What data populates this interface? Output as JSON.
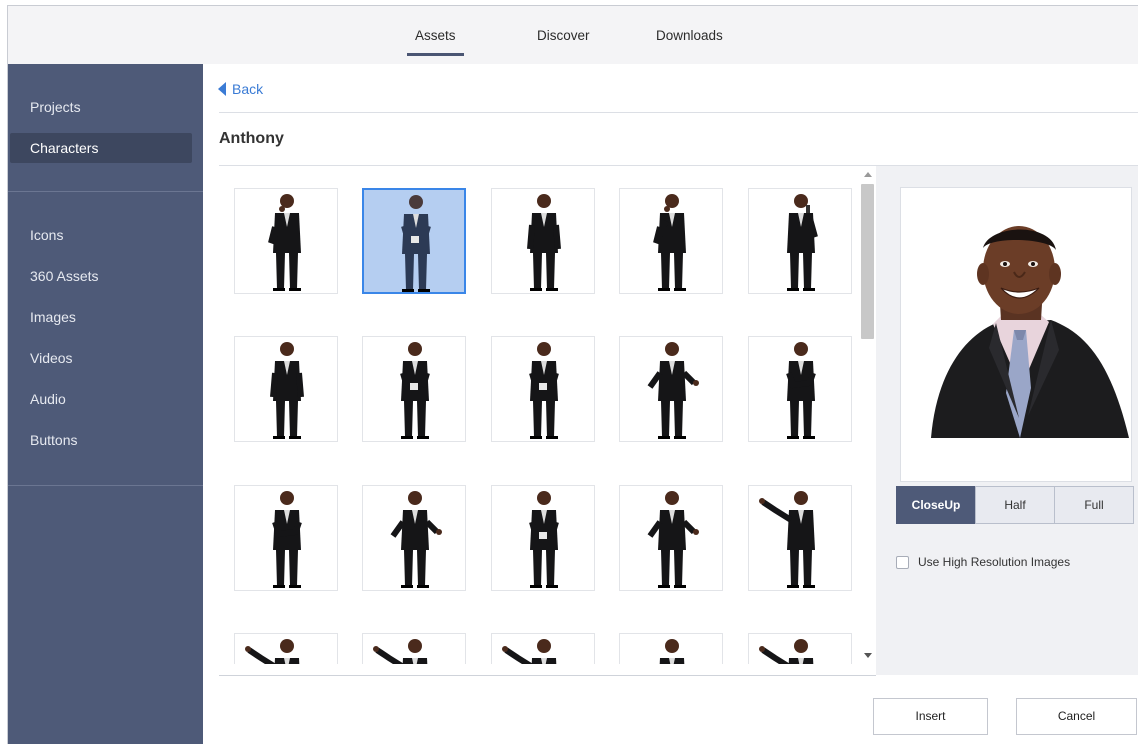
{
  "top_tabs": [
    {
      "label": "Assets",
      "active": true
    },
    {
      "label": "Discover",
      "active": false
    },
    {
      "label": "Downloads",
      "active": false
    }
  ],
  "sidebar": {
    "items": [
      {
        "label": "Projects",
        "active": false
      },
      {
        "label": "Characters",
        "active": true
      },
      {
        "label": "Icons",
        "active": false
      },
      {
        "label": "360 Assets",
        "active": false
      },
      {
        "label": "Images",
        "active": false
      },
      {
        "label": "Videos",
        "active": false
      },
      {
        "label": "Audio",
        "active": false
      },
      {
        "label": "Buttons",
        "active": false
      }
    ]
  },
  "back_label": "Back",
  "character_name": "Anthony",
  "grid": {
    "selected_index": 1,
    "thumbs": [
      {
        "pose": "hand-chin"
      },
      {
        "pose": "holding-tablet"
      },
      {
        "pose": "standing"
      },
      {
        "pose": "hand-chin"
      },
      {
        "pose": "phone"
      },
      {
        "pose": "standing"
      },
      {
        "pose": "holding-cup"
      },
      {
        "pose": "holding-cup"
      },
      {
        "pose": "gesture-cup"
      },
      {
        "pose": "hands-clasped"
      },
      {
        "pose": "arms-crossed"
      },
      {
        "pose": "open-arms"
      },
      {
        "pose": "holding-phone"
      },
      {
        "pose": "gesture"
      },
      {
        "pose": "pointing-up"
      },
      {
        "pose": "pointing"
      },
      {
        "pose": "pointing"
      },
      {
        "pose": "pointing"
      },
      {
        "pose": "standing"
      },
      {
        "pose": "pointing"
      }
    ]
  },
  "preview": {
    "view_options": [
      {
        "label": "CloseUp",
        "active": true
      },
      {
        "label": "Half",
        "active": false
      },
      {
        "label": "Full",
        "active": false
      }
    ],
    "hires_label": "Use High Resolution Images",
    "hires_checked": false
  },
  "footer": {
    "insert_label": "Insert",
    "cancel_label": "Cancel"
  },
  "colors": {
    "sidebar_bg": "#4e5a78",
    "accent_blue": "#3a7bd5",
    "selected_fill": "#b5cef1"
  }
}
